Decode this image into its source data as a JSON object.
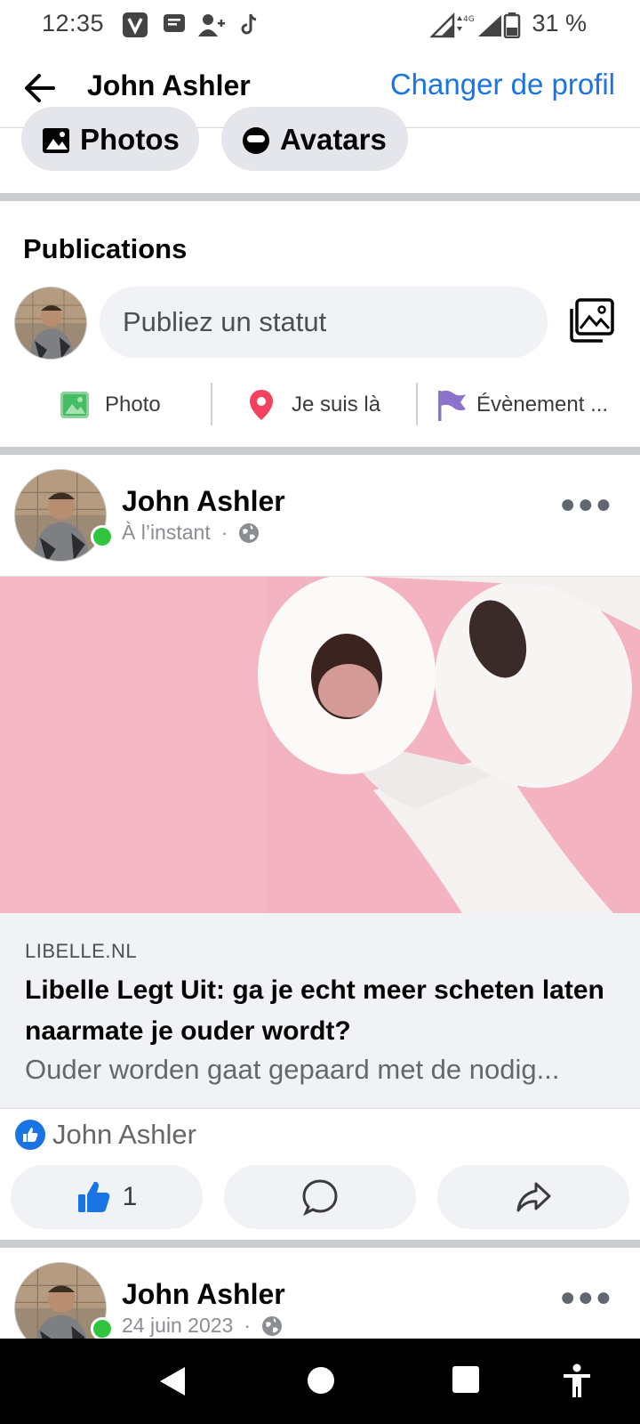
{
  "status_bar": {
    "time": "12:35",
    "network": "4G",
    "battery": "31 %"
  },
  "header": {
    "back_icon": "arrow-left-icon",
    "title": "John Ashler",
    "switch_profile": "Changer de profil"
  },
  "profile_pills": [
    {
      "label": "Photos",
      "icon": "photos-icon"
    },
    {
      "label": "Avatars",
      "icon": "avatar-icon"
    }
  ],
  "composer": {
    "section_title": "Publications",
    "placeholder": "Publiez un statut",
    "actions": [
      {
        "label": "Photo",
        "icon": "photo-icon",
        "color": "#45bd62"
      },
      {
        "label": "Je suis là",
        "icon": "location-pin-icon",
        "color": "#f3425f"
      },
      {
        "label": "Évènement ...",
        "icon": "flag-icon",
        "color": "#8c72cb"
      }
    ]
  },
  "posts": [
    {
      "author": "John Ashler",
      "time": "À l’instant",
      "privacy_icon": "globe-icon",
      "link": {
        "domain": "LIBELLE.NL",
        "title": "Libelle Legt Uit: ga je echt meer scheten laten naarmate je ouder wordt?",
        "description": "Ouder worden gaat gepaard met de nodig..."
      },
      "reactions": {
        "names": "John Ashler",
        "like_count": "1"
      }
    },
    {
      "author": "John Ashler",
      "time": "24 juin 2023",
      "privacy_icon": "globe-icon"
    }
  ],
  "colors": {
    "accent": "#1b74e4",
    "online": "#31c53f",
    "divider": "#c9ccd1",
    "pill_bg": "#e4e6eb"
  }
}
